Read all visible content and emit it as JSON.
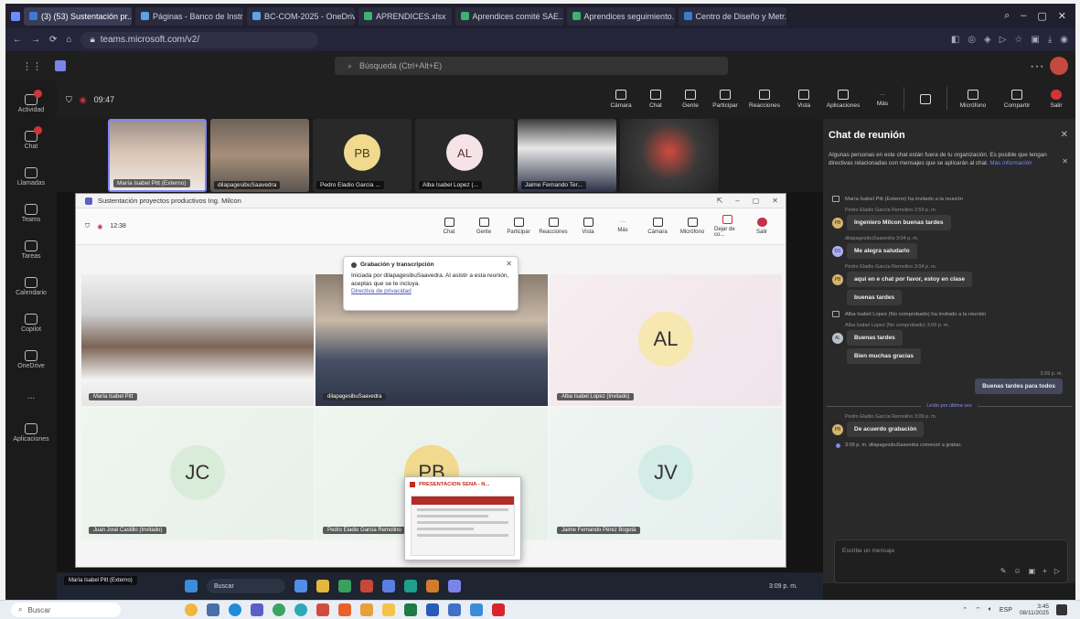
{
  "browser": {
    "tabs": [
      {
        "label": "(3) (53) Sustentación pr..."
      },
      {
        "label": "Páginas - Banco de Instr..."
      },
      {
        "label": "BC-COM-2025 - OneDrive"
      },
      {
        "label": "APRENDICES.xlsx"
      },
      {
        "label": "Aprendices comité SAE..."
      },
      {
        "label": "Aprendices seguimiento..."
      },
      {
        "label": "Centro de Diseño y Metr..."
      }
    ],
    "url": "teams.microsoft.com/v2/"
  },
  "teams": {
    "search_placeholder": "Búsqueda (Ctrl+Alt+E)",
    "rail": [
      {
        "label": "Actividad"
      },
      {
        "label": "Chat"
      },
      {
        "label": "Llamadas"
      },
      {
        "label": "Teams"
      },
      {
        "label": "Tareas"
      },
      {
        "label": "Calendario"
      },
      {
        "label": "Copilot"
      },
      {
        "label": "OneDrive"
      },
      {
        "label": "..."
      },
      {
        "label": "Aplicaciones"
      }
    ],
    "meeting_time": "09:47",
    "controls": [
      "Cámara",
      "Chat",
      "Gente",
      "Participar",
      "Reacciones",
      "Vista",
      "Aplicaciones",
      "Más",
      "Micrófono",
      "Compartir",
      "Salir"
    ]
  },
  "participants_strip": [
    {
      "name": "María Isabel Pitt (Externo)",
      "kind": "photo1"
    },
    {
      "name": "dilapagesibuSaavedra",
      "kind": "photo2"
    },
    {
      "name": "Pedro Eladio García ...",
      "initials": "PB",
      "color": "#f1d98e"
    },
    {
      "name": "Alba Isabel Lopez (...",
      "initials": "AL",
      "color": "#f6e3e8"
    },
    {
      "name": "Jaime Fernando Ter...",
      "kind": "photo3"
    },
    {
      "name": "",
      "kind": "photo4"
    }
  ],
  "popout": {
    "title": "Sustentación proyectos productivos Ing. Milcon",
    "time": "12:38",
    "controls": [
      "Chat",
      "Gente",
      "Participar",
      "Reacciones",
      "Vista",
      "Más",
      "Cámara",
      "Micrófono",
      "Dejar de co...",
      "Salir"
    ],
    "notice": {
      "title": "Grabación y transcripción",
      "body": "Iniciada por dilapagesibuSaavedra. Al asistir a esta reunión, aceptas que se te incluya.",
      "link": "Directiva de privacidad"
    },
    "tiles": [
      {
        "name": "María Isabel Pitt",
        "kind": "v1"
      },
      {
        "name": "dilapagesibuSaavedra",
        "kind": "v2"
      },
      {
        "name": "Alba Isabel Lopez (Invitado)",
        "initials": "AL",
        "bg": "pink",
        "color": "#f7e7b0"
      },
      {
        "name": "Juan José Castillo (Invitado)",
        "initials": "JC",
        "bg": "green",
        "color": "#d9ecd9"
      },
      {
        "name": "Pedro Eladio Garcia Remolino",
        "initials": "PB",
        "bg": "green",
        "color": "#f1d98e"
      },
      {
        "name": "Jaime Fernando Pérez Bogotá",
        "initials": "JV",
        "bg": "mint",
        "color": "#d4ece6"
      }
    ],
    "thumbnail_title": "PRESENTACION SENA - N..."
  },
  "chat": {
    "title": "Chat de reunión",
    "info": "Algunas personas en este chat están fuera de tu organización. Es posible que tengan directivas relacionadas con mensajes que se aplicarán al chat.",
    "info_link": "Más información",
    "messages": [
      {
        "type": "sys",
        "text": "María Isabel Pitt (Externo) ha invitado a la reunión"
      },
      {
        "type": "msg",
        "meta": "Pedro Eladio García Remolino 2:59 p. m.",
        "avatar": "PB",
        "av": "gold",
        "text": "Ingeniero Milcon buenas tardes"
      },
      {
        "type": "msg",
        "meta": "dilapagesibuSaavedra 3:04 p. m.",
        "avatar": "DS",
        "av": "lav",
        "text": "Me alegra saludarlo"
      },
      {
        "type": "msg",
        "meta": "Pedro Eladio García Remolino 3:04 p. m.",
        "avatar": "PB",
        "av": "gold",
        "text": "aquí en e chat por favor, estoy en clase",
        "cont": "buenas tardes"
      },
      {
        "type": "sys",
        "text": "Alba Isabel Lopez (No comprobado) ha invitado a la reunión"
      },
      {
        "type": "msg",
        "meta": "Alba Isabel Lopez (No comprobado) 3:09 p. m.",
        "avatar": "AL",
        "av": "gry",
        "text": "Buenas tardes",
        "cont": "Bien muchas gracias"
      }
    ],
    "mine_meta": "3:09 p. m.",
    "mine_text": "Buenas tardes para todos",
    "divider": "Leído por última vez",
    "last": {
      "meta": "Pedro Eladio García Remolino 3:09 p. m.",
      "avatar": "PB",
      "text": "De acuerdo grabación"
    },
    "recording": "3:09 p. m.   dilapagesibuSaavedra comenzó a grabar.",
    "compose_placeholder": "Escribe un mensaje"
  },
  "inner_taskbar": {
    "name_label": "María Isabel Pitt (Externo)",
    "search": "Buscar",
    "clock": "3:09 p. m."
  },
  "taskbar": {
    "search": "Buscar",
    "lang": "ESP",
    "time": "3:45",
    "date": "08/11/2025"
  }
}
